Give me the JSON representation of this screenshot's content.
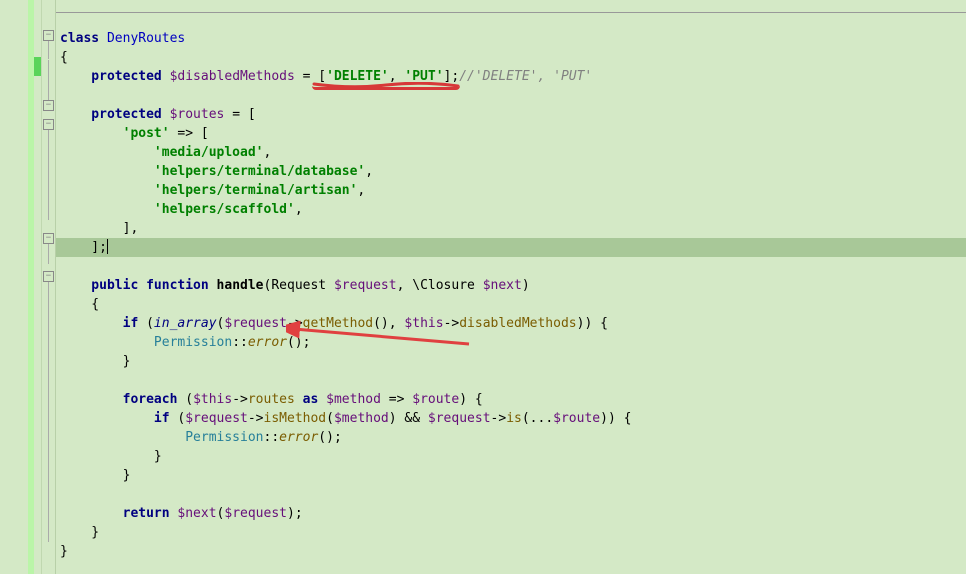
{
  "code": {
    "l1": "class ",
    "l1b": "DenyRoutes",
    "l2": "{",
    "l3a": "    protected ",
    "l3b": "$disabledMethods ",
    "l3c": "= [",
    "l3d": "'DELETE'",
    "l3e": ", ",
    "l3f": "'PUT'",
    "l3g": "];",
    "l3h": "//'DELETE', 'PUT'",
    "l4a": "    protected ",
    "l4b": "$routes ",
    "l4c": "= [",
    "l5a": "        'post' ",
    "l5b": "=> [",
    "l6": "            'media/upload'",
    "l6b": ",",
    "l7": "            'helpers/terminal/database'",
    "l7b": ",",
    "l8": "            'helpers/terminal/artisan'",
    "l8b": ",",
    "l9": "            'helpers/scaffold'",
    "l9b": ",",
    "l10": "        ],",
    "l11": "    ];",
    "l12a": "    public function ",
    "l12b": "handle",
    "l12c": "(Request ",
    "l12d": "$request",
    "l12e": ", \\Closure ",
    "l12f": "$next",
    "l12g": ")",
    "l13": "    {",
    "l14a": "        if ",
    "l14b": "(",
    "l14c": "in_array",
    "l14d": "(",
    "l14e": "$request",
    "l14f": "->",
    "l14g": "getMethod",
    "l14h": "(), ",
    "l14i": "$this",
    "l14j": "->",
    "l14k": "disabledMethods",
    "l14l": ")) {",
    "l15a": "            Permission",
    "l15b": "::",
    "l15c": "error",
    "l15d": "();",
    "l16": "        }",
    "l17a": "        foreach ",
    "l17b": "(",
    "l17c": "$this",
    "l17d": "->",
    "l17e": "routes ",
    "l17f": "as ",
    "l17g": "$method ",
    "l17h": "=> ",
    "l17i": "$route",
    "l17j": ") {",
    "l18a": "            if ",
    "l18b": "(",
    "l18c": "$request",
    "l18d": "->",
    "l18e": "isMethod",
    "l18f": "(",
    "l18g": "$method",
    "l18h": ") && ",
    "l18i": "$request",
    "l18j": "->",
    "l18k": "is",
    "l18l": "(...",
    "l18m": "$route",
    "l18n": ")) {",
    "l19a": "                Permission",
    "l19b": "::",
    "l19c": "error",
    "l19d": "();",
    "l20": "            }",
    "l21": "        }",
    "l22a": "        return ",
    "l22b": "$next",
    "l22c": "(",
    "l22d": "$request",
    "l22e": ");",
    "l23": "    }",
    "l24": "}"
  }
}
